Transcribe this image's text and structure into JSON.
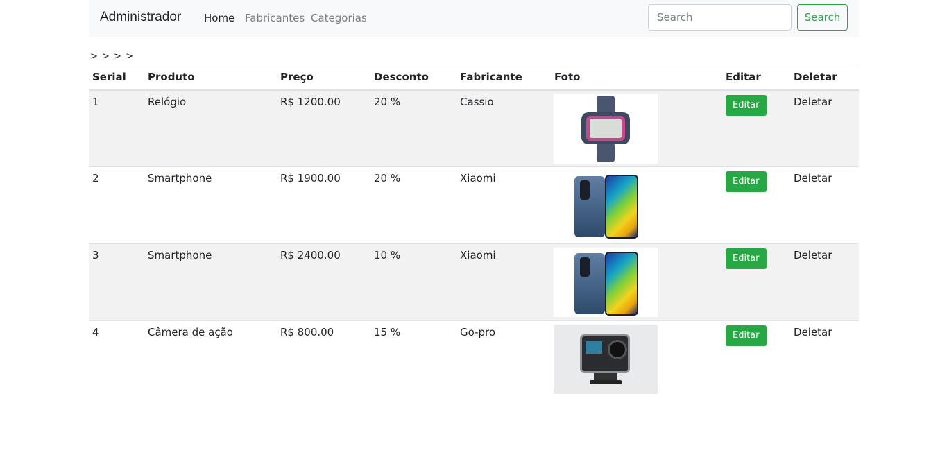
{
  "navbar": {
    "brand": "Administrador",
    "links": [
      {
        "label": "Home",
        "active": true
      },
      {
        "label": "Fabricantes",
        "active": false
      },
      {
        "label": "Categorias",
        "active": false
      }
    ],
    "search_placeholder": "Search",
    "search_button": "Search"
  },
  "breadcrumb": "> > > >",
  "table": {
    "headers": [
      "Serial",
      "Produto",
      "Preço",
      "Desconto",
      "Fabricante",
      "Foto",
      "Editar",
      "Deletar"
    ],
    "rows": [
      {
        "serial": "1",
        "produto": "Relógio",
        "preco": "R$ 1200.00",
        "desconto": "20 %",
        "fabricante": "Cassio",
        "foto": "watch-photo",
        "editar": "Editar",
        "deletar": "Deletar"
      },
      {
        "serial": "2",
        "produto": "Smartphone",
        "preco": "R$ 1900.00",
        "desconto": "20 %",
        "fabricante": "Xiaomi",
        "foto": "smartphone-photo",
        "editar": "Editar",
        "deletar": "Deletar"
      },
      {
        "serial": "3",
        "produto": "Smartphone",
        "preco": "R$ 2400.00",
        "desconto": "10 %",
        "fabricante": "Xiaomi",
        "foto": "smartphone-photo",
        "editar": "Editar",
        "deletar": "Deletar"
      },
      {
        "serial": "4",
        "produto": "Câmera de ação",
        "preco": "R$ 800.00",
        "desconto": "15 %",
        "fabricante": "Go-pro",
        "foto": "action-camera-photo",
        "editar": "Editar",
        "deletar": "Deletar"
      }
    ]
  },
  "colors": {
    "success": "#28a745",
    "navbar_bg": "#f8f9fa",
    "stripe": "#f2f2f2"
  }
}
